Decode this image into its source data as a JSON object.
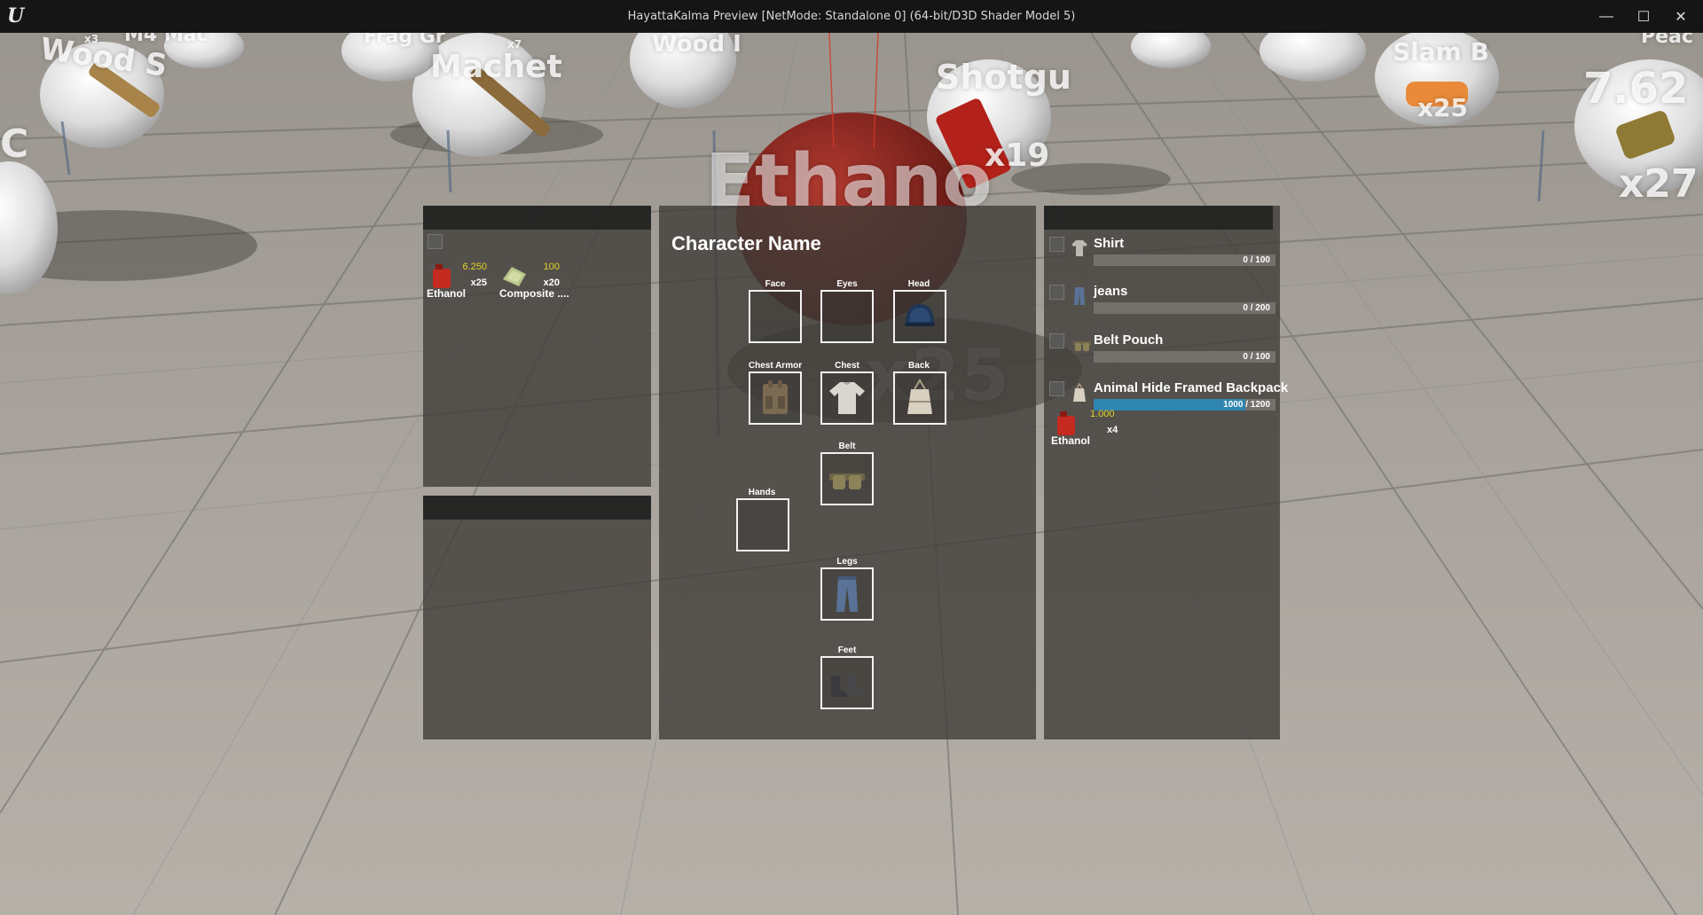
{
  "window": {
    "title": "HayattaKalma Preview [NetMode: Standalone 0]  (64-bit/D3D Shader Model 5)",
    "minimize_glyph": "—",
    "maximize_glyph": "☐",
    "close_glyph": "✕",
    "logo_glyph": "U"
  },
  "world_labels": {
    "wood_left": "Wood S",
    "machete": "Machet",
    "frag": "Frag Gr",
    "wood_center": "Wood I",
    "x7": "x7",
    "x3": "x3",
    "m4": "M4 Mac",
    "slam": "Slam B",
    "x25_right": "x25",
    "shotgun": "Shotgu",
    "x19": "x19",
    "ammo762": "7.62",
    "x27": "x27",
    "ethanol_big": "Ethano",
    "x25_center": "x25",
    "c_left": "C",
    "peace": "Peac"
  },
  "ground_inventory": {
    "items": [
      {
        "name": "Ethanol",
        "weight": "6.250",
        "qty": "x25",
        "icon": "gas-can-icon"
      },
      {
        "name": "Composite ....",
        "weight": "100",
        "qty": "x20",
        "icon": "composite-material-icon"
      }
    ]
  },
  "character": {
    "title": "Character Name",
    "slots": {
      "face": "Face",
      "eyes": "Eyes",
      "head": "Head",
      "chest_armor": "Chest Armor",
      "chest": "Chest",
      "back": "Back",
      "belt": "Belt",
      "hands": "Hands",
      "legs": "Legs",
      "feet": "Feet"
    }
  },
  "equipment": {
    "items": [
      {
        "name": "Shirt",
        "capacity": "0 / 100",
        "fill": 0.0,
        "icon": "shirt-icon"
      },
      {
        "name": "jeans",
        "capacity": "0 / 200",
        "fill": 0.0,
        "icon": "jeans-icon"
      },
      {
        "name": "Belt Pouch",
        "capacity": "0 / 100",
        "fill": 0.0,
        "icon": "belt-pouch-icon"
      },
      {
        "name": "Animal Hide Framed Backpack",
        "capacity": "1000 / 1200",
        "fill": 0.833,
        "icon": "backpack-icon"
      }
    ],
    "backpack_contents": [
      {
        "name": "Ethanol",
        "weight": "1.000",
        "qty": "x4",
        "icon": "gas-can-icon"
      }
    ]
  },
  "colors": {
    "weight_text": "#e4d32a",
    "capacity_fill": "#2f86b0",
    "panel_bg": "#403c38"
  }
}
